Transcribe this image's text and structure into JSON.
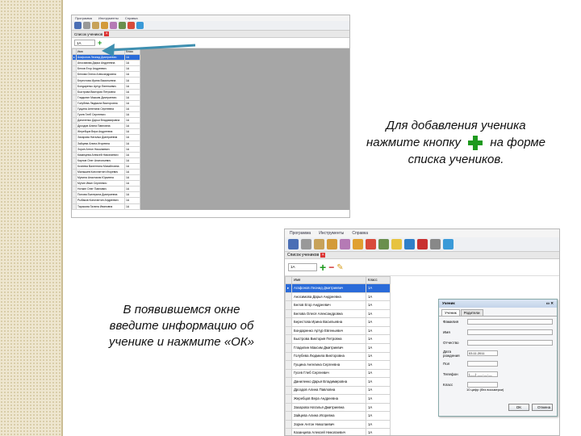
{
  "instructions": {
    "add_line1": "Для добавления ученика",
    "add_line2a": "нажмите кнопку",
    "add_line2b": "на форме",
    "add_line3": "списка учеников.",
    "enter_line1": "В появившемся окне",
    "enter_line2": "введите информацию об",
    "enter_line3": "ученике и нажмите «ОК»"
  },
  "app": {
    "menu": [
      "Программа",
      "Инструменты",
      "Справка"
    ],
    "form_title": "Список учеников",
    "class_value": "1А",
    "columns": [
      "Имя",
      "Класс"
    ]
  },
  "students": [
    [
      "Агафонов Леонид Дмитриевич",
      "1А"
    ],
    [
      "Аносимова Дарья Андреевна",
      "1А"
    ],
    [
      "Белов Егор Андреевич",
      "1А"
    ],
    [
      "Белова Олеся Александровна",
      "1А"
    ],
    [
      "Берестова Ирина Васильевна",
      "1А"
    ],
    [
      "Бондаренко Артур Евгеньевич",
      "1А"
    ],
    [
      "Быстрова Виктория Петровна",
      "1А"
    ],
    [
      "Гладилин Максим Дмитриевич",
      "1А"
    ],
    [
      "Голубева Людмила Викторовна",
      "1А"
    ],
    [
      "Гущина Ангелина Сергеевна",
      "1А"
    ],
    [
      "Гусев Глеб Сергеевич",
      "1А"
    ],
    [
      "Даниленко Дарья Владимировна",
      "1А"
    ],
    [
      "Дроздов Алина Павловна",
      "1А"
    ],
    [
      "Жеребцов Вера Андреевна",
      "1А"
    ],
    [
      "Захарова Наталья Дмитриевна",
      "1А"
    ],
    [
      "Зайцева Алина Игоревна",
      "1А"
    ],
    [
      "Зорин Антон Николаевич",
      "1А"
    ],
    [
      "Казанцева Алексей Николаевич",
      "1А"
    ],
    [
      "Карпов Олег Анатольевич",
      "1А"
    ],
    [
      "Кочнева Валентина Михайловна",
      "1А"
    ],
    [
      "Малышев Константин Игоревич",
      "1А"
    ],
    [
      "Мухина Анастасия Юрьевна",
      "1А"
    ],
    [
      "Мутин Иван Сергеевич",
      "1А"
    ],
    [
      "Ноткин Олег Павлович",
      "1А"
    ],
    [
      "Попова Екатерина Дмитриевна",
      "1А"
    ],
    [
      "Рыбаков Константин Андреевич",
      "1А"
    ],
    [
      "Тарасова Галина Ивановна",
      "1А"
    ]
  ],
  "dialog": {
    "title": "Ученик",
    "tabs": [
      "Ученик",
      "Родители"
    ],
    "fields": [
      {
        "label": "Фамилия",
        "value": ""
      },
      {
        "label": "Имя",
        "value": ""
      },
      {
        "label": "Отчество",
        "value": ""
      },
      {
        "label": "Дата рождения",
        "value": "03.11.2011"
      },
      {
        "label": "Пол",
        "value": ""
      },
      {
        "label": "Телефон",
        "value": "(___) ___-__-__"
      },
      {
        "label": "Класс",
        "value": ""
      }
    ],
    "phone_hint": "10 цифр (без восьмерки)",
    "ok": "OK",
    "cancel": "Отмена"
  },
  "colors": {
    "accent_green": "#1e9a1e",
    "selected_row": "#2a6bd9",
    "arrow": "#3e8fb0"
  }
}
